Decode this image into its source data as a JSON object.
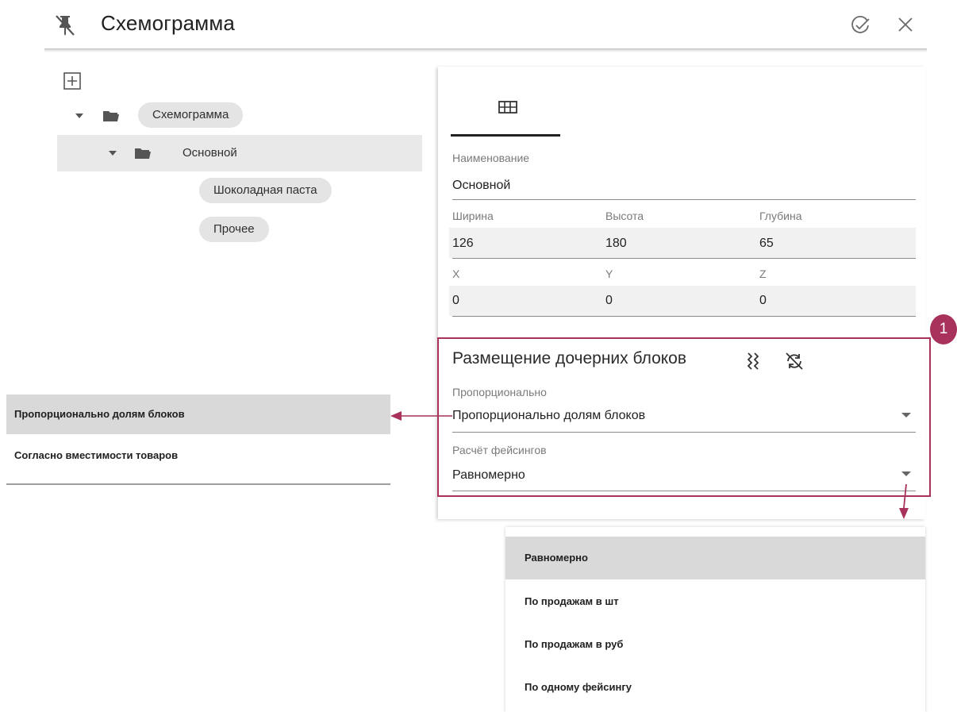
{
  "header": {
    "title": "Схемограмма",
    "pin_icon": "pin-off-icon",
    "confirm_icon": "check-circle-icon",
    "close_icon": "close-icon"
  },
  "tree": {
    "add_icon": "add-box-icon",
    "root": {
      "label": "Схемограмма",
      "expanded": true
    },
    "child": {
      "label": "Основной",
      "expanded": true,
      "selected": true
    },
    "leaves": [
      {
        "label": "Шоколадная паста"
      },
      {
        "label": "Прочее"
      }
    ]
  },
  "panel": {
    "tab_icon": "table-layout-icon",
    "name": {
      "label": "Наименование",
      "value": "Основной"
    },
    "dimensions": [
      {
        "label": "Ширина",
        "value": "126"
      },
      {
        "label": "Высота",
        "value": "180"
      },
      {
        "label": "Глубина",
        "value": "65"
      }
    ],
    "coords": [
      {
        "label": "X",
        "value": "0"
      },
      {
        "label": "Y",
        "value": "0"
      },
      {
        "label": "Z",
        "value": "0"
      }
    ],
    "placement": {
      "title": "Размещение дочерних блоков",
      "icon1": "distribute-vertical-icon",
      "icon2": "sync-disabled-icon",
      "proportional": {
        "label": "Пропорционально",
        "value": "Пропорционально долям блоков"
      },
      "facing": {
        "label": "Расчёт фейсингов",
        "value": "Равномерно"
      }
    }
  },
  "callout": {
    "number": "1",
    "color": "#a8325c"
  },
  "left_menu": {
    "items": [
      {
        "label": "Пропорционально долям блоков",
        "selected": true
      },
      {
        "label": "Согласно вместимости товаров",
        "selected": false
      }
    ]
  },
  "bottom_menu": {
    "items": [
      {
        "label": "Равномерно",
        "selected": true
      },
      {
        "label": "По продажам в шт",
        "selected": false
      },
      {
        "label": "По продажам в руб",
        "selected": false
      },
      {
        "label": "По одному фейсингу",
        "selected": false
      }
    ]
  }
}
